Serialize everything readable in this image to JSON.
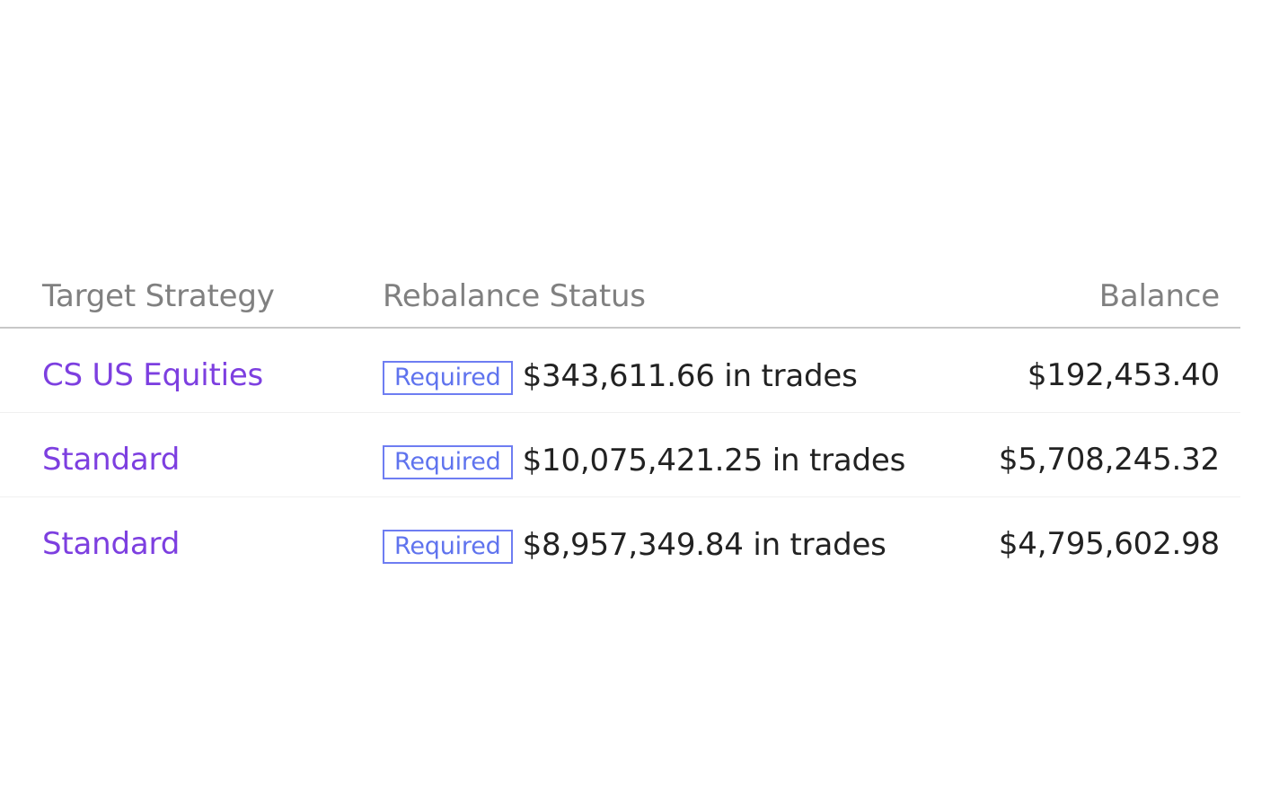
{
  "table": {
    "headers": {
      "strategy": "Target Strategy",
      "status": "Rebalance Status",
      "balance": "Balance"
    },
    "rows": [
      {
        "strategy": "CS US Equities",
        "badge": "Required",
        "trades": "$343,611.66 in trades",
        "balance": "$192,453.40"
      },
      {
        "strategy": "Standard",
        "badge": "Required",
        "trades": "$10,075,421.25 in trades",
        "balance": "$5,708,245.32"
      },
      {
        "strategy": "Standard",
        "badge": "Required",
        "trades": "$8,957,349.84 in trades",
        "balance": "$4,795,602.98"
      }
    ]
  },
  "colors": {
    "link": "#7d3fe0",
    "badge_border": "#6e7df2",
    "header_text": "#808080",
    "body_text": "#222222"
  }
}
